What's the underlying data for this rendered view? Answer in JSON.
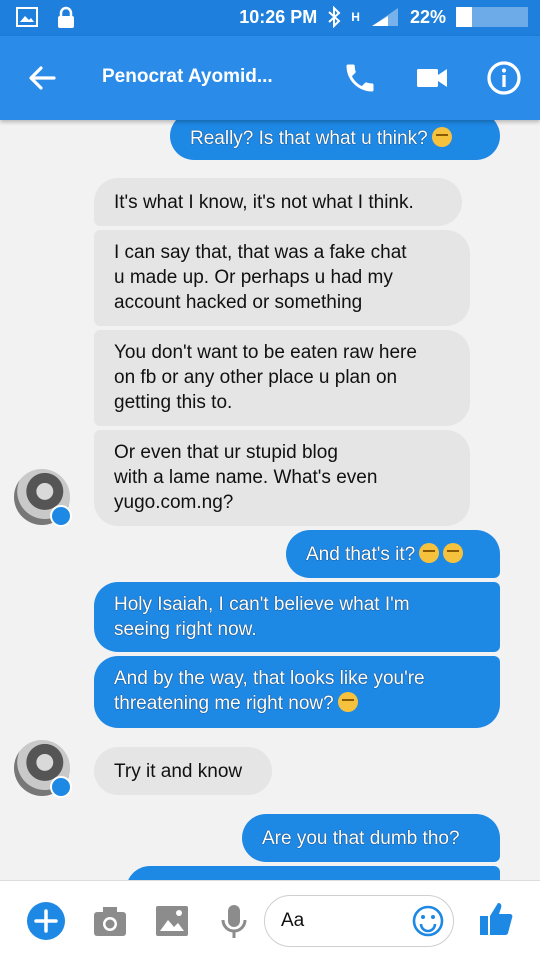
{
  "status": {
    "time": "10:26 PM",
    "network": "H",
    "battery_text": "22%",
    "battery_level": 0.22
  },
  "header": {
    "title": "Penocrat Ayomid..."
  },
  "messages": {
    "m0": "Really? Is that what u think?",
    "m1": "It's what I know, it's not what I think.",
    "m2_l1": "I can say that, that was a fake chat",
    "m2_l2": "u made up. Or perhaps u had my",
    "m2_l3": "account hacked or something",
    "m3_l1": "You don't want to be eaten raw here",
    "m3_l2": "on fb or any other place u plan on",
    "m3_l3": "getting this to.",
    "m4_l1": "Or even that ur stupid blog",
    "m4_l2": "with a lame name. What's even",
    "m4_l3": "yugo.com.ng?",
    "m5": "And that's it?",
    "m6_l1": "Holy Isaiah, I can't believe what I'm",
    "m6_l2": "seeing right now.",
    "m7_l1": "And by the way, that looks like you're",
    "m7_l2": "threatening me right now?",
    "m8": "Try it and know",
    "m9": "Are you that dumb tho?"
  },
  "composer": {
    "placeholder": "Aa"
  },
  "colors": {
    "header": "#2b8be8",
    "statusbar": "#1e7fdc",
    "outgoing_bubble": "#1e88e5",
    "incoming_bubble": "#e5e5e5"
  }
}
